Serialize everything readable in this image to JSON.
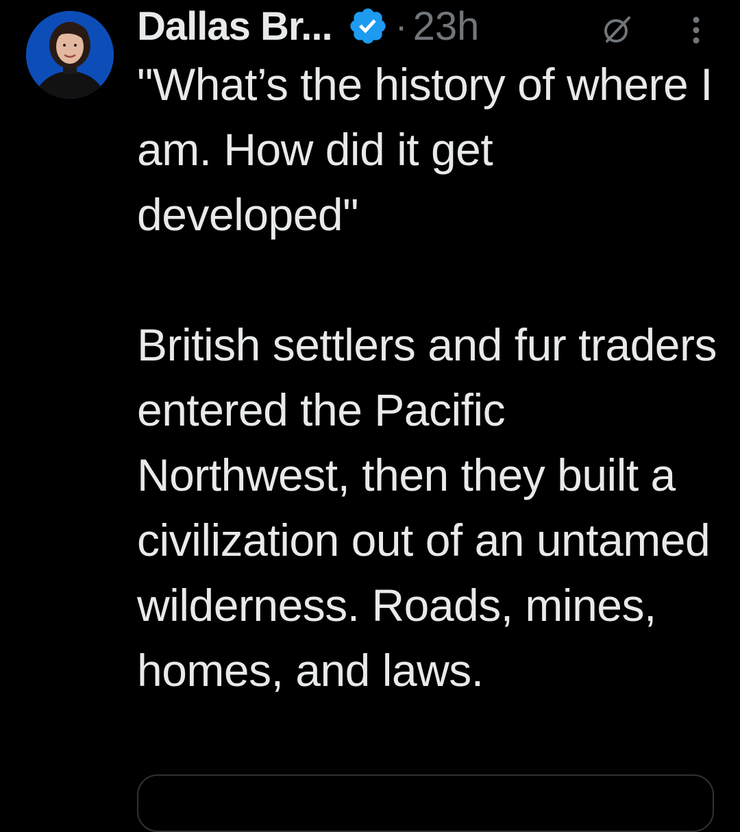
{
  "tweet": {
    "author_name": "Dallas Br...",
    "separator": "·",
    "timestamp": "23h",
    "text": "\"What’s the history of where I am. How did it get developed\"\n\nBritish settlers and fur traders entered the Pacific Northwest, then they built a civilization out of an untamed wilderness. Roads, mines, homes, and laws.",
    "verified": true
  },
  "icons": {
    "verified": "verified-badge-icon",
    "grok": "grok-icon",
    "more": "more-vertical-icon"
  },
  "colors": {
    "background": "#000000",
    "text_primary": "#e7e9ea",
    "text_secondary": "#71767b",
    "verified_blue": "#1d9bf0",
    "avatar_bg": "#0d4db8",
    "card_border": "#2f3336"
  }
}
